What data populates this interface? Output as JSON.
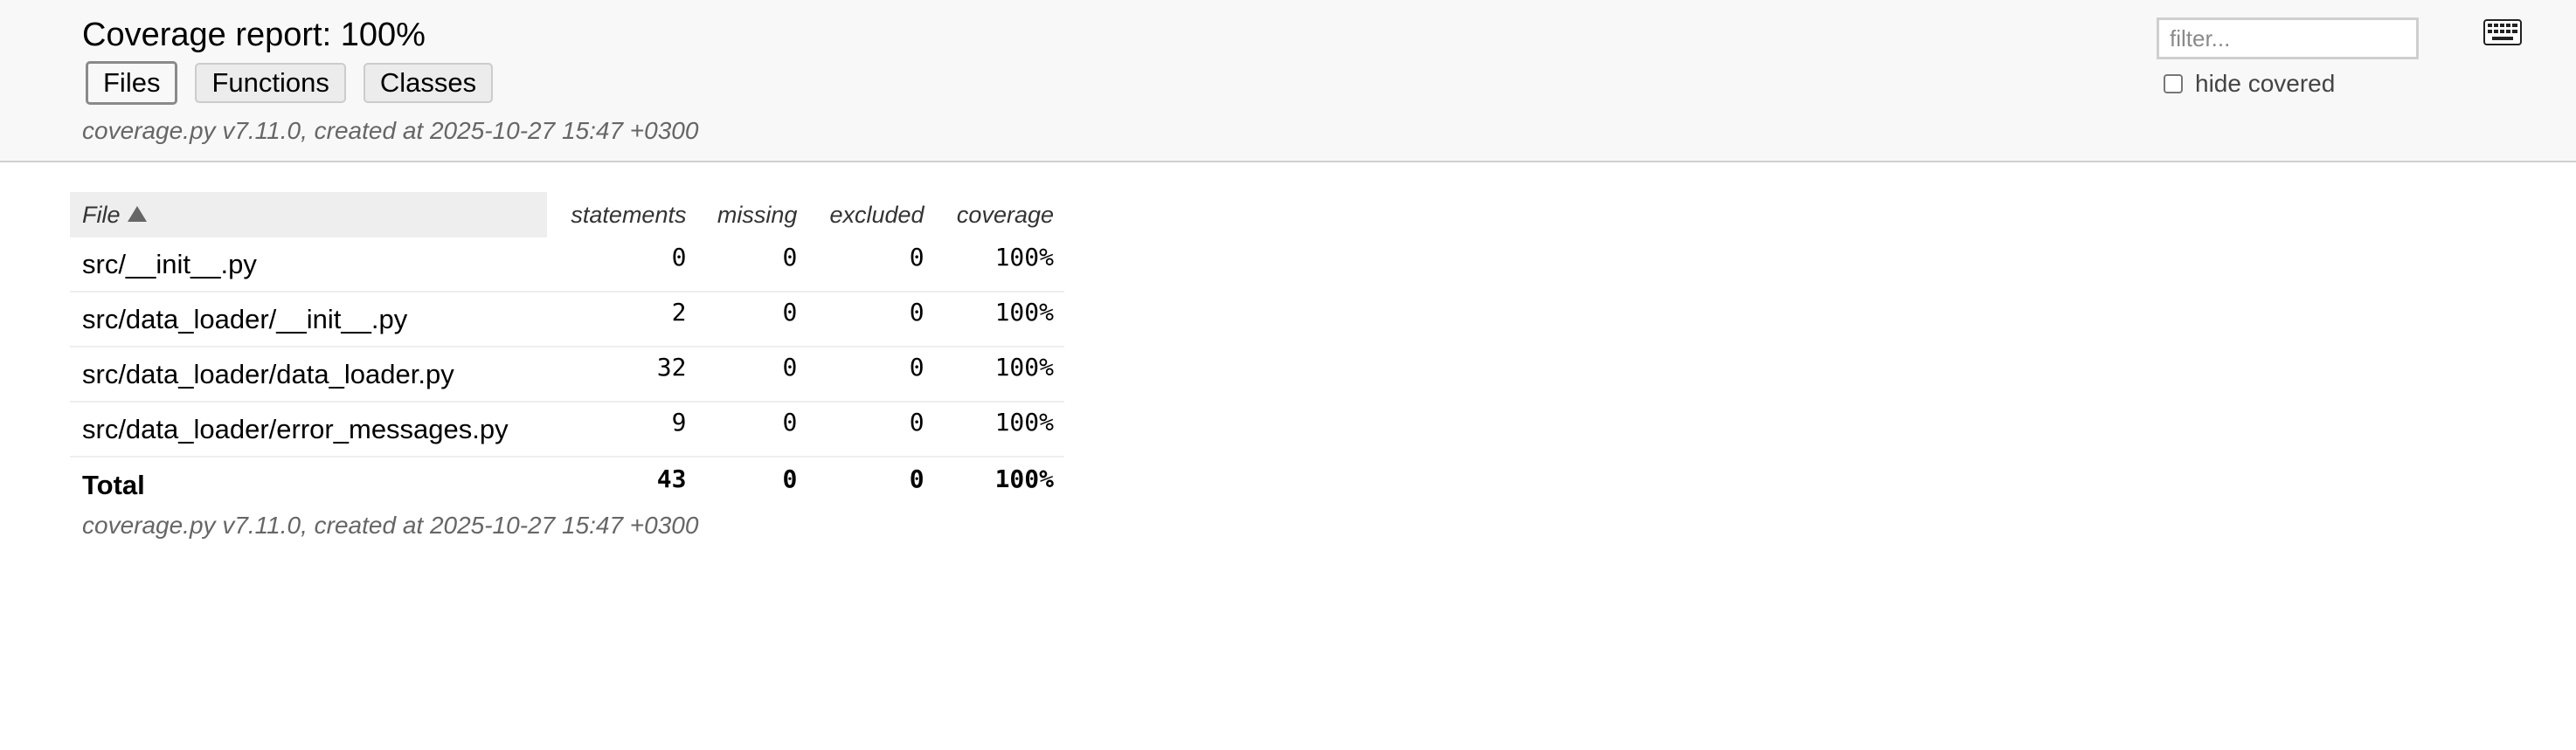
{
  "header": {
    "title": "Coverage report: 100%",
    "tabs": [
      {
        "label": "Files",
        "active": true
      },
      {
        "label": "Functions",
        "active": false
      },
      {
        "label": "Classes",
        "active": false
      }
    ],
    "meta_text": "coverage.py v7.11.0, created at 2025-10-27 15:47 +0300",
    "filter_placeholder": "filter...",
    "hide_covered_label": "hide covered",
    "hide_covered_checked": false,
    "keyboard_icon": "keyboard-icon"
  },
  "table": {
    "columns": {
      "file": "File",
      "statements": "statements",
      "missing": "missing",
      "excluded": "excluded",
      "coverage": "coverage"
    },
    "sort_indicator": "sort-ascending-icon",
    "rows": [
      {
        "file": "src/__init__.py",
        "statements": "0",
        "missing": "0",
        "excluded": "0",
        "coverage": "100%"
      },
      {
        "file": "src/data_loader/__init__.py",
        "statements": "2",
        "missing": "0",
        "excluded": "0",
        "coverage": "100%"
      },
      {
        "file": "src/data_loader/data_loader.py",
        "statements": "32",
        "missing": "0",
        "excluded": "0",
        "coverage": "100%"
      },
      {
        "file": "src/data_loader/error_messages.py",
        "statements": "9",
        "missing": "0",
        "excluded": "0",
        "coverage": "100%"
      }
    ],
    "total": {
      "file": "Total",
      "statements": "43",
      "missing": "0",
      "excluded": "0",
      "coverage": "100%"
    }
  },
  "footer": {
    "meta_text": "coverage.py v7.11.0, created at 2025-10-27 15:47 +0300"
  },
  "colors": {
    "header_bg": "#f8f8f8",
    "meta_text": "#666666",
    "sorted_header_bg": "#eeeeee"
  }
}
